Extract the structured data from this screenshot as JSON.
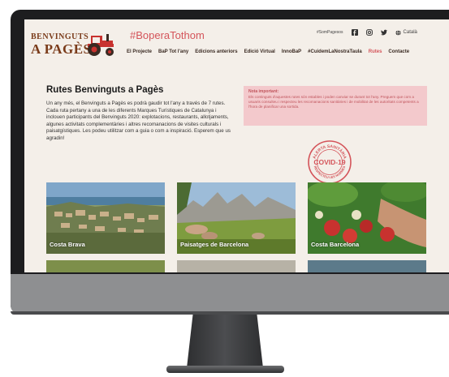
{
  "site": {
    "logo_line1": "BENVINGUTS",
    "logo_line2": "A PAGÈS",
    "hashtag": "#BoperaTothom",
    "social_hashtag": "#SomPagesos",
    "language": "Català"
  },
  "nav": {
    "items": [
      "El Projecte",
      "BaP Tot l'any",
      "Edicions anteriors",
      "Edició Virtual",
      "InnoBaP",
      "#CuidemLaNostraTaula",
      "Rutes",
      "Contacte"
    ],
    "active": "Rutes"
  },
  "main": {
    "title": "Rutes Benvinguts a Pagès",
    "intro": "Un any més, el Benvinguts a Pagès es podrà gaudir tot l'any a través de 7 rutes. Cada ruta pertany a una de les diferents Marques Turístiques de Catalunya i inclouen participants del Benvinguts 2020: explotacions, restaurants, allotjaments, algunes activitats complementàries i altres recomanacions de visites culturals i paisatgístiques. Les podeu utilitzar com a guia o com a inspiració. Esperem que us agradin!"
  },
  "note": {
    "title": "Nota important:",
    "text": "Els continguts d'aquestes rutes són estables i poden canviar se durant tot l'any. Preguem que com a usuaris consulteu i respecteu les recomanacions sanitàries i de mobilitat de les autoritats competents a l'hora de planificar una sortida."
  },
  "stamp": {
    "top_text": "ALERTA SANITÀRIA",
    "main_text": "COVID-19",
    "bottom_text": "RESPECTEU LES NORMES",
    "color": "#d4545a"
  },
  "routes": [
    {
      "label": "Costa Brava"
    },
    {
      "label": "Paisatges de Barcelona"
    },
    {
      "label": "Costa Barcelona"
    }
  ],
  "colors": {
    "accent": "#d4545a",
    "background": "#f4efe9",
    "note_bg": "#f3c9cc",
    "logo_brown": "#7a3b1a"
  },
  "icons": [
    "facebook-icon",
    "instagram-icon",
    "twitter-icon",
    "globe-icon",
    "tractor-icon"
  ]
}
